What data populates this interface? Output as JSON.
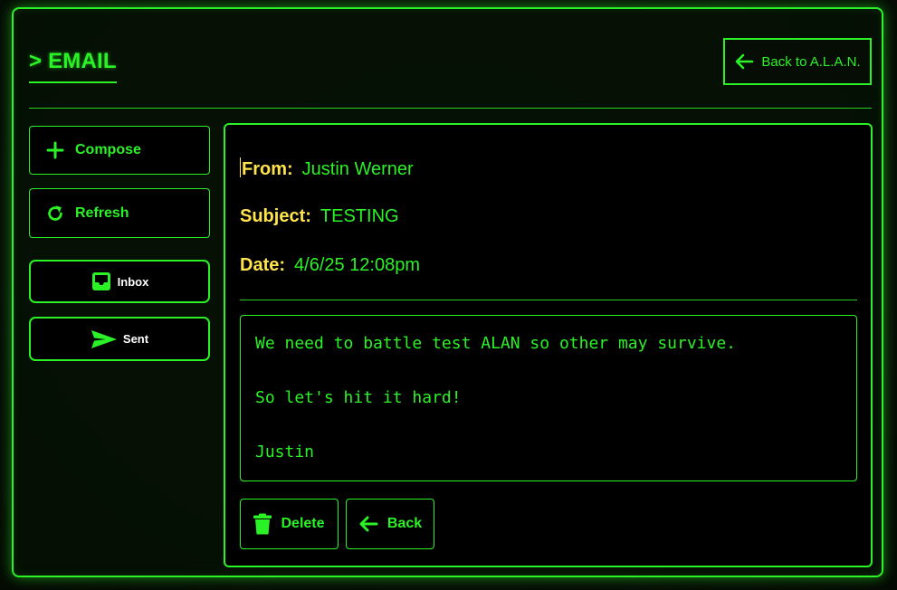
{
  "header": {
    "title": "> EMAIL",
    "back_label": "Back to A.L.A.N."
  },
  "sidebar": {
    "compose_label": "Compose",
    "refresh_label": "Refresh",
    "inbox_label": "Inbox",
    "sent_label": "Sent"
  },
  "email": {
    "from_key": "From:",
    "from_value": "Justin Werner",
    "subject_key": "Subject:",
    "subject_value": "TESTING",
    "date_key": "Date:",
    "date_value": "4/6/25 12:08pm",
    "body_lines": [
      "We need to battle test ALAN so other may survive.",
      "So let's hit it hard!",
      "Justin"
    ]
  },
  "actions": {
    "delete_label": "Delete",
    "back_label": "Back"
  },
  "icons": {
    "back_alan": "arrow-left-icon",
    "compose": "plus-icon",
    "refresh": "refresh-icon",
    "inbox": "inbox-icon",
    "sent": "send-icon",
    "delete": "trash-icon",
    "back": "arrow-left-icon"
  },
  "colors": {
    "accent": "#2bf226",
    "label": "#ffe44a",
    "nav_text": "#ffffff",
    "background": "#000000"
  }
}
